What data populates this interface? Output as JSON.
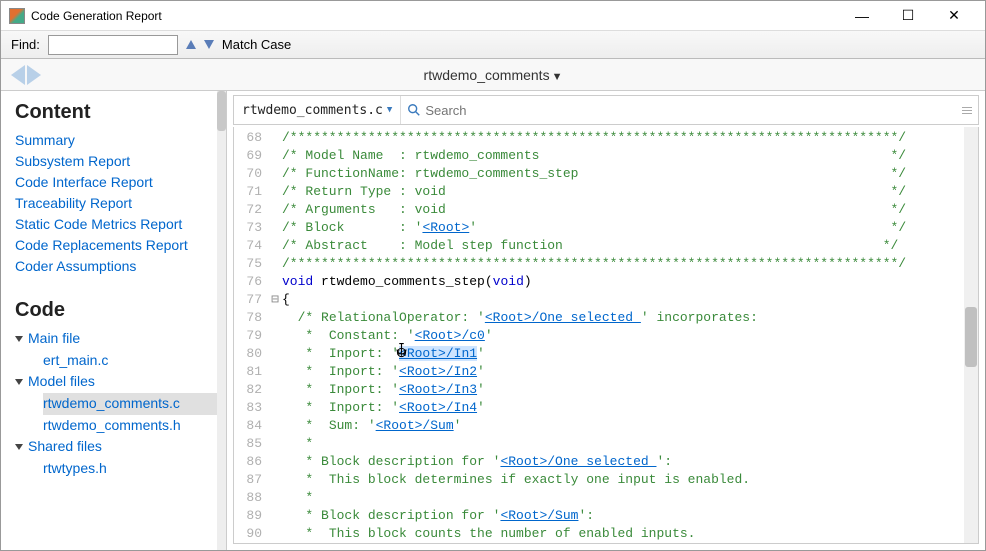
{
  "window": {
    "title": "Code Generation Report"
  },
  "findbar": {
    "label": "Find:",
    "value": "",
    "match_case": "Match Case"
  },
  "nav": {
    "title": "rtwdemo_comments"
  },
  "sidebar": {
    "content_heading": "Content",
    "links": [
      "Summary",
      "Subsystem Report",
      "Code Interface Report",
      "Traceability Report",
      "Static Code Metrics Report",
      "Code Replacements Report",
      "Coder Assumptions"
    ],
    "code_heading": "Code",
    "groups": [
      {
        "label": "Main file",
        "children": [
          "ert_main.c"
        ]
      },
      {
        "label": "Model files",
        "children": [
          "rtwdemo_comments.c",
          "rtwdemo_comments.h"
        ],
        "selected": 0
      },
      {
        "label": "Shared files",
        "children": [
          "rtwtypes.h"
        ]
      }
    ]
  },
  "editor": {
    "file": "rtwdemo_comments.c",
    "search_placeholder": "Search"
  },
  "code": {
    "lines": [
      {
        "n": 68,
        "html": "<span class='cm'>/******************************************************************************/</span>"
      },
      {
        "n": 69,
        "html": "<span class='cm'>/* Model Name  : rtwdemo_comments                                             */</span>"
      },
      {
        "n": 70,
        "html": "<span class='cm'>/* FunctionName: rtwdemo_comments_step                                        */</span>"
      },
      {
        "n": 71,
        "html": "<span class='cm'>/* Return Type : void                                                         */</span>"
      },
      {
        "n": 72,
        "html": "<span class='cm'>/* Arguments   : void                                                         */</span>"
      },
      {
        "n": 73,
        "html": "<span class='cm'>/* Block       : '</span><span class='lnk'>&lt;Root&gt;</span><span class='cm'>'                                                     */</span>"
      },
      {
        "n": 74,
        "html": "<span class='cm'>/* Abstract    : Model step function                                         */</span>"
      },
      {
        "n": 75,
        "html": "<span class='cm'>/******************************************************************************/</span>"
      },
      {
        "n": 76,
        "html": "<span class='kw'>void</span> <span class='fn'>rtwdemo_comments_step</span>(<span class='kw'>void</span>)"
      },
      {
        "n": 77,
        "gut": "⊟",
        "html": "{"
      },
      {
        "n": 78,
        "html": "  <span class='cm'>/* RelationalOperator: '</span><span class='lnk'>&lt;Root&gt;/One selected </span><span class='cm'>' incorporates:</span>"
      },
      {
        "n": 79,
        "html": "  <span class='cm'> *  Constant: '</span><span class='lnk'>&lt;Root&gt;/c0</span><span class='cm'>'</span>"
      },
      {
        "n": 80,
        "html": "  <span class='cm'> *  Inport: '</span><span class='lnk hl'>&lt;Root&gt;/In1</span><span class='cm'>'</span>"
      },
      {
        "n": 81,
        "html": "  <span class='cm'> *  Inport: '</span><span class='lnk'>&lt;Root&gt;/In2</span><span class='cm'>'</span>"
      },
      {
        "n": 82,
        "html": "  <span class='cm'> *  Inport: '</span><span class='lnk'>&lt;Root&gt;/In3</span><span class='cm'>'</span>"
      },
      {
        "n": 83,
        "html": "  <span class='cm'> *  Inport: '</span><span class='lnk'>&lt;Root&gt;/In4</span><span class='cm'>'</span>"
      },
      {
        "n": 84,
        "html": "  <span class='cm'> *  Sum: '</span><span class='lnk'>&lt;Root&gt;/Sum</span><span class='cm'>'</span>"
      },
      {
        "n": 85,
        "html": "  <span class='cm'> *</span>"
      },
      {
        "n": 86,
        "html": "  <span class='cm'> * Block description for '</span><span class='lnk'>&lt;Root&gt;/One selected </span><span class='cm'>':</span>"
      },
      {
        "n": 87,
        "html": "  <span class='cm'> *  This block determines if exactly one input is enabled.</span>"
      },
      {
        "n": 88,
        "html": "  <span class='cm'> *</span>"
      },
      {
        "n": 89,
        "html": "  <span class='cm'> * Block description for '</span><span class='lnk'>&lt;Root&gt;/Sum</span><span class='cm'>':</span>"
      },
      {
        "n": 90,
        "html": "  <span class='cm'> *  This block counts the number of enabled inputs.</span>"
      }
    ]
  }
}
